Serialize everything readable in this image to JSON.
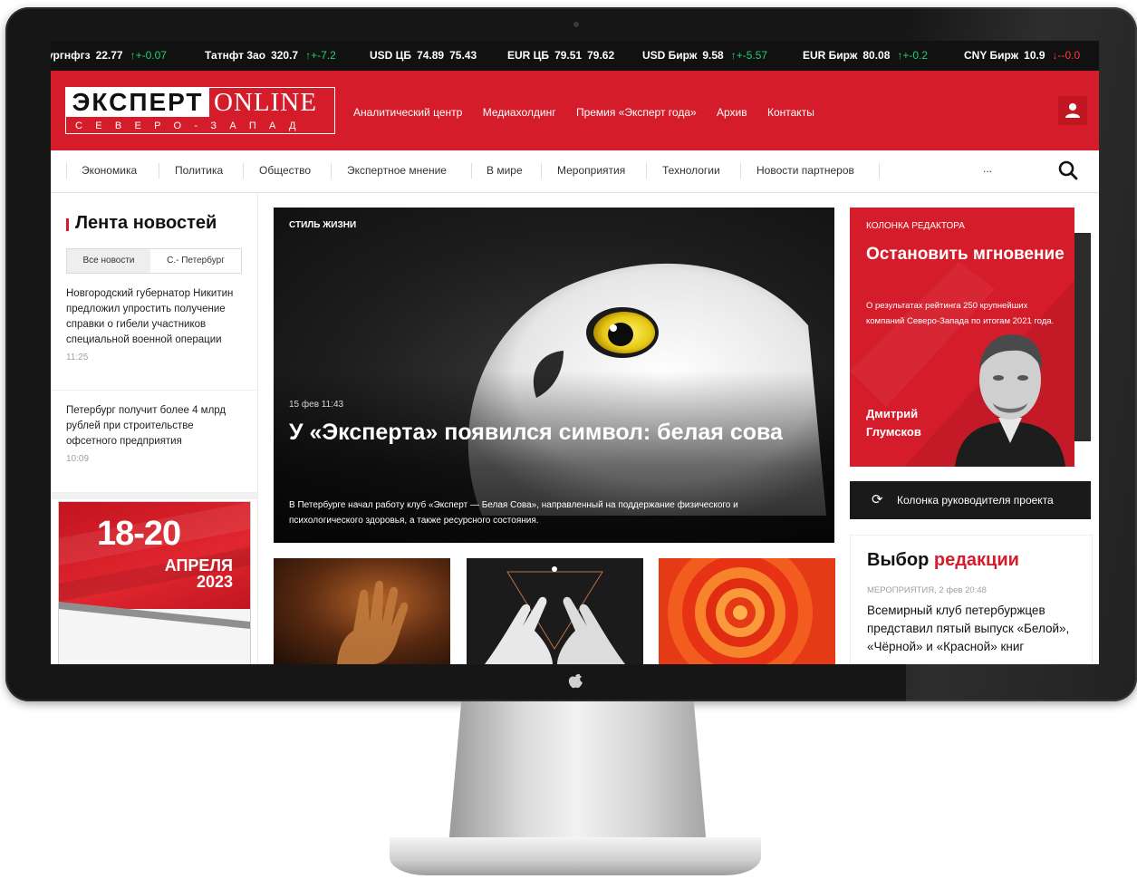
{
  "ticker": [
    {
      "name": "ургнфгз",
      "value": "22.77",
      "change": "↑+-0.07",
      "dir": "up"
    },
    {
      "name": "Татнфт 3ао",
      "value": "320.7",
      "change": "↑+-7.2",
      "dir": "up"
    },
    {
      "name": "USD ЦБ",
      "value": "74.89",
      "value2": "75.43",
      "change": "",
      "dir": ""
    },
    {
      "name": "EUR ЦБ",
      "value": "79.51",
      "value2": "79.62",
      "change": "",
      "dir": ""
    },
    {
      "name": "USD Бирж",
      "value": "9.58",
      "change": "↑+-5.57",
      "dir": "up"
    },
    {
      "name": "EUR Бирж",
      "value": "80.08",
      "change": "↑+-0.2",
      "dir": "up"
    },
    {
      "name": "CNY Бирж",
      "value": "10.9",
      "change": "↓--0.0",
      "dir": "down"
    }
  ],
  "logo": {
    "ekspert": "ЭКСПЕРТ",
    "online": "ONLINE",
    "region": "СЕВЕРО-ЗАПАД"
  },
  "header_nav": [
    "Аналитический центр",
    "Медиахолдинг",
    "Премия «Эксперт года»",
    "Архив",
    "Контакты"
  ],
  "categories": [
    "Экономика",
    "Политика",
    "Общество",
    "Экспертное мнение",
    "В мире",
    "Мероприятия",
    "Технологии",
    "Новости партнеров",
    "..."
  ],
  "feed": {
    "title": "Лента новостей",
    "tabs": [
      "Все новости",
      "С.- Петербург"
    ],
    "items": [
      {
        "text": "Новгородский губернатор Никитин предложил упростить получение справки о гибели участников специальной военной операции",
        "time": "11:25"
      },
      {
        "text": "Петербург получит более 4 млрд рублей при строительстве офсетного предприятия",
        "time": "10:09"
      }
    ]
  },
  "banner": {
    "dates": "18-20",
    "month": "АПРЕЛЯ",
    "year": "2023"
  },
  "hero": {
    "rubric": "СТИЛЬ ЖИЗНИ",
    "date": "15 фев 11:43",
    "title": "У «Эксперта» появился символ: белая сова",
    "lead": "В Петербурге начал работу клуб «Эксперт — Белая Сова», направленный на поддержание физического и психологического здоровья, а также ресурсного состояния."
  },
  "editor": {
    "label": "КОЛОНКА РЕДАКТОРА",
    "title": "Остановить мгновение",
    "lead": "О результатах рейтинга 250 крупнейших компаний Северо-Запада по итогам 2021 года.",
    "author": "Дмитрий Глумсков"
  },
  "project_button": {
    "label": "Колонка руководителя проекта",
    "icon": "refresh-icon"
  },
  "choice": {
    "title_black": "Выбор",
    "title_red": "редакции",
    "meta": "МЕРОПРИЯТИЯ, 2 фев 20:48",
    "headline": "Всемирный клуб петербуржцев представил пятый выпуск «Белой», «Чёрной» и «Красной» книг"
  },
  "colors": {
    "brand_red": "#d51c2a",
    "ticker_up": "#1fd16b",
    "ticker_down": "#ff3b30",
    "dark": "#1a1a1a"
  }
}
